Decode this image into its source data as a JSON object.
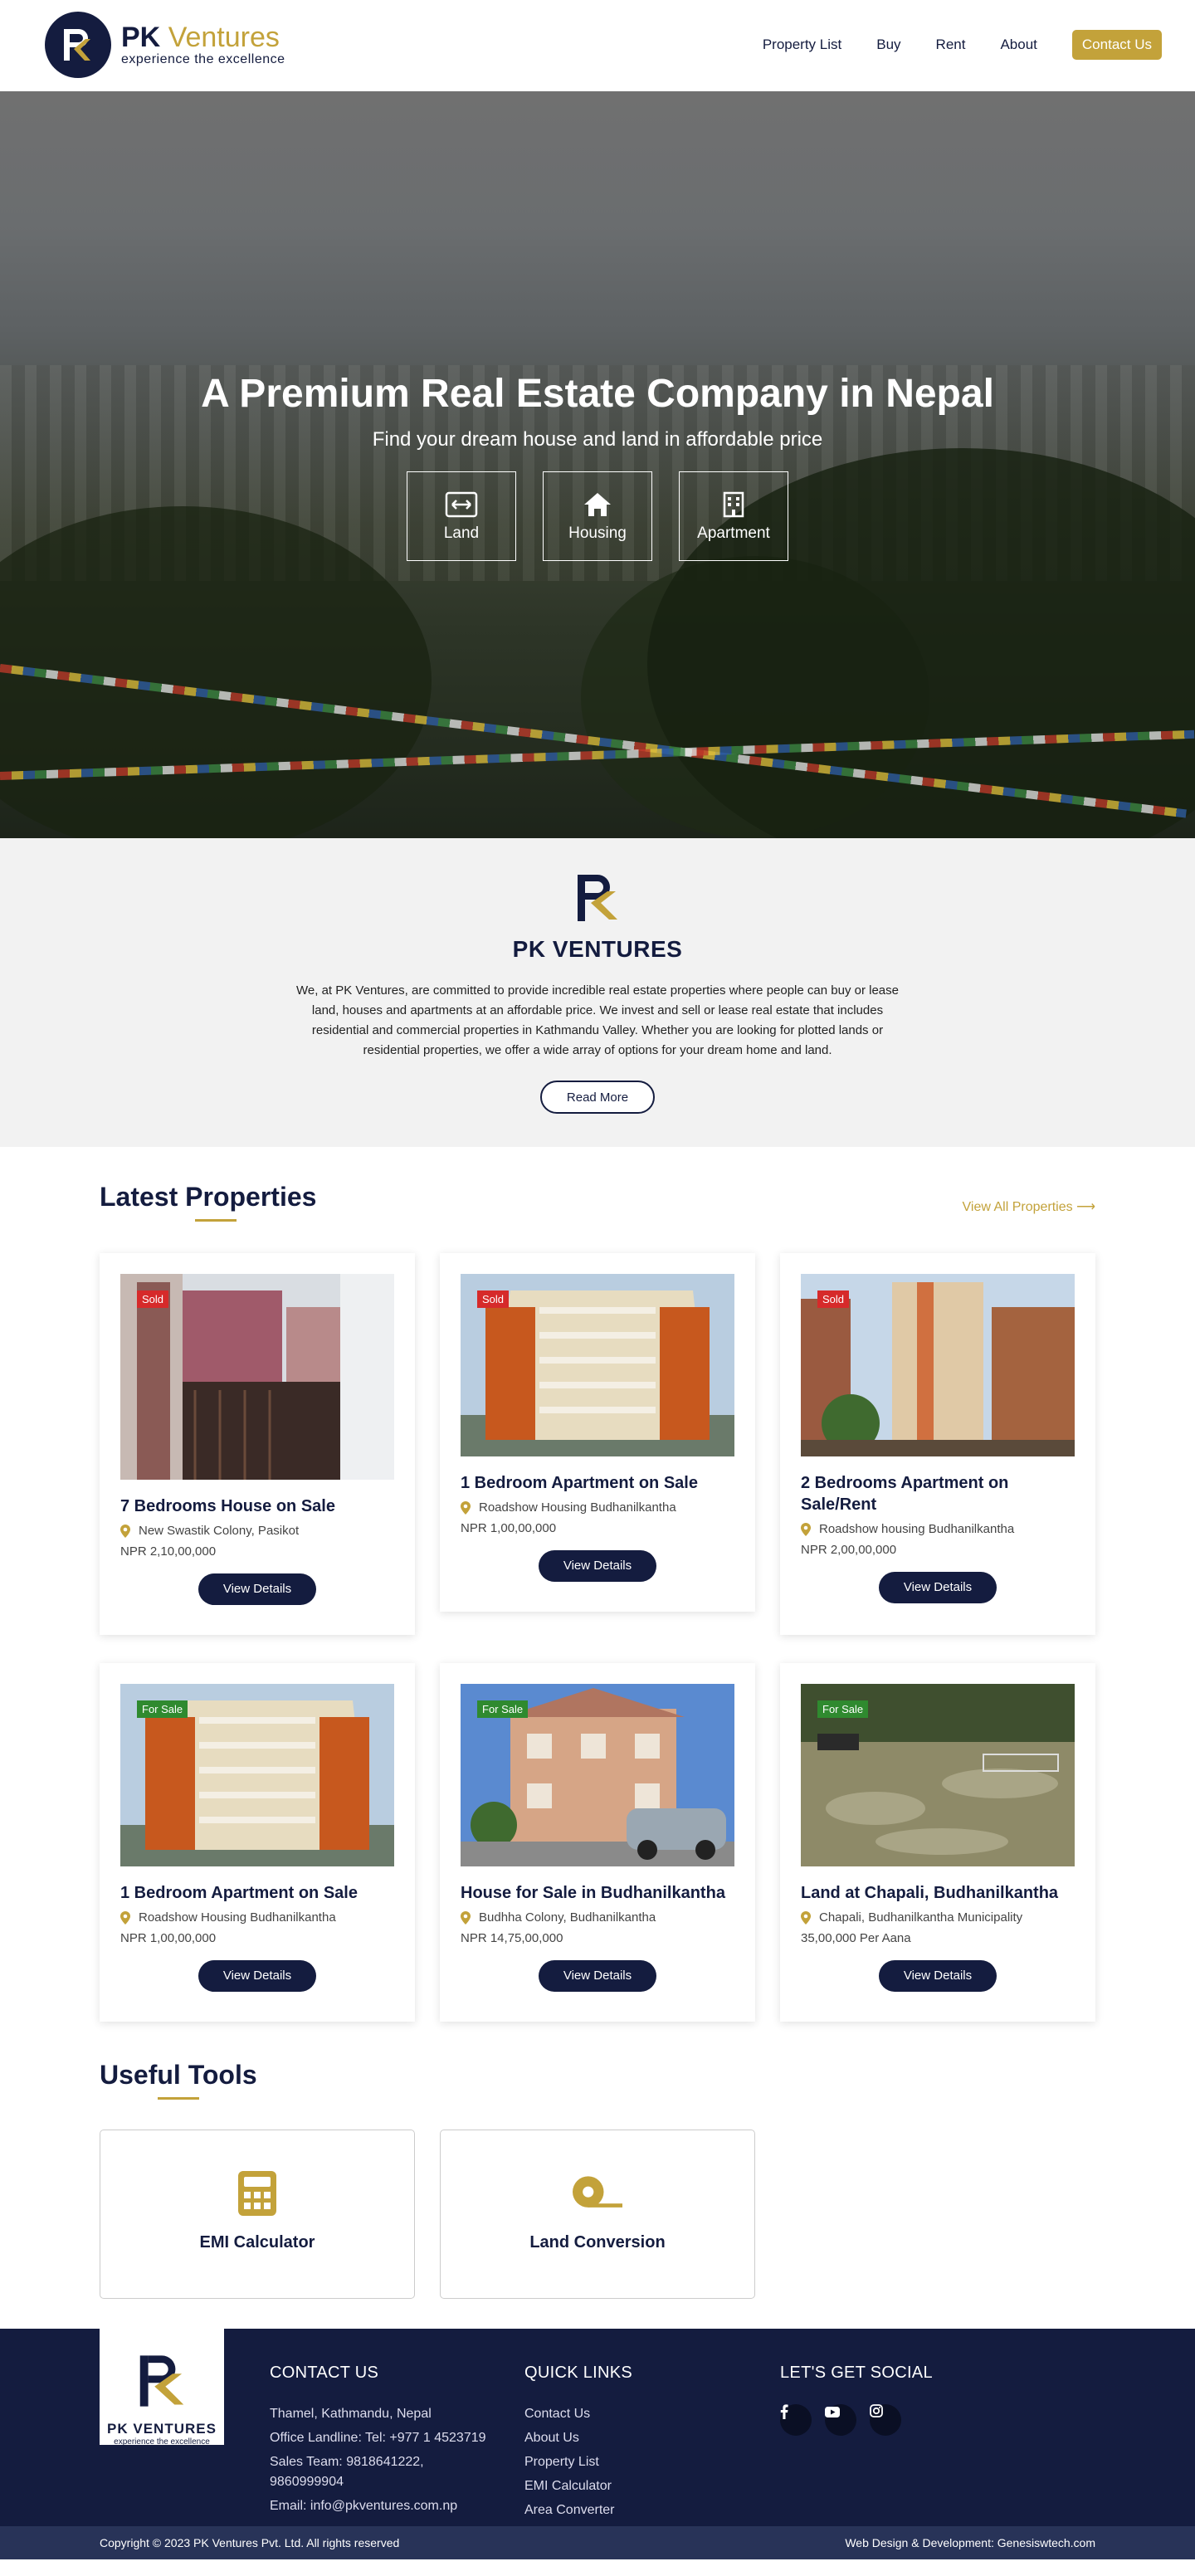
{
  "brand": {
    "name_main": "PK",
    "name_accent": "Ventures",
    "tagline": "experience the excellence",
    "colors": {
      "navy": "#141c3f",
      "gold": "#c3a23a",
      "sold": "#d62a2a",
      "for_sale": "#2f8a2f"
    }
  },
  "nav": {
    "items": [
      {
        "label": "Property List"
      },
      {
        "label": "Buy"
      },
      {
        "label": "Rent"
      },
      {
        "label": "About"
      }
    ],
    "cta": "Contact Us"
  },
  "hero": {
    "title": "A Premium Real Estate Company in Nepal",
    "subtitle": "Find your dream house and land in affordable price",
    "categories": [
      {
        "label": "Land",
        "icon": "arrows-horizontal-icon"
      },
      {
        "label": "Housing",
        "icon": "house-icon"
      },
      {
        "label": "Apartment",
        "icon": "building-icon"
      }
    ]
  },
  "about": {
    "title": "PK VENTURES",
    "text": "We, at PK Ventures, are committed to provide incredible real estate properties where people can buy or lease land, houses and apartments at an affordable price. We invest and sell or lease real estate that includes residential and commercial properties in Kathmandu Valley. Whether you are looking for plotted lands or residential properties, we offer a wide array of options for your dream home and land.",
    "button": "Read More"
  },
  "latest": {
    "title_light": "Latest",
    "title_bold": "Properties",
    "view_all": "View All Properties ⟶",
    "button_label": "View Details",
    "cards": [
      {
        "badge": "Sold",
        "title": "7 Bedrooms House on Sale",
        "location": "New Swastik Colony, Pasikot",
        "price": "NPR 2,10,00,000"
      },
      {
        "badge": "Sold",
        "title": "1 Bedroom Apartment on Sale",
        "location": "Roadshow Housing Budhanilkantha",
        "price": "NPR 1,00,00,000"
      },
      {
        "badge": "Sold",
        "title": "2 Bedrooms Apartment on Sale/Rent",
        "location": "Roadshow housing Budhanilkantha",
        "price": "NPR 2,00,00,000"
      },
      {
        "badge": "For Sale",
        "title": "1 Bedroom Apartment on Sale",
        "location": "Roadshow Housing Budhanilkantha",
        "price": "NPR 1,00,00,000"
      },
      {
        "badge": "For Sale",
        "title": "House for Sale in Budhanilkantha",
        "location": "Budhha Colony, Budhanilkantha",
        "price": "NPR 14,75,00,000"
      },
      {
        "badge": "For Sale",
        "title": "Land at Chapali, Budhanilkantha",
        "location": "Chapali, Budhanilkantha Municipality",
        "price": "35,00,000 Per Aana"
      }
    ]
  },
  "tools": {
    "title_light": "Useful",
    "title_bold": "Tools",
    "items": [
      {
        "label": "EMI Calculator",
        "icon": "calculator-icon"
      },
      {
        "label": "Land Conversion",
        "icon": "tape-measure-icon"
      }
    ]
  },
  "footer": {
    "logo_title": "PK VENTURES",
    "logo_sub": "experience the excellence",
    "contact": {
      "heading": "CONTACT US",
      "address": "Thamel, Kathmandu, Nepal",
      "landline": "Office Landline: Tel: +977 1 4523719",
      "sales": "Sales Team: 9818641222, 9860999904",
      "email": "Email: info@pkventures.com.np"
    },
    "quick_links": {
      "heading": "QUICK LINKS",
      "items": [
        "Contact Us",
        "About Us",
        "Property List",
        "EMI Calculator",
        "Area Converter"
      ]
    },
    "social": {
      "heading": "LET'S GET SOCIAL",
      "icons": [
        "facebook-icon",
        "youtube-icon",
        "instagram-icon"
      ]
    },
    "copyright": "Copyright © 2023 PK Ventures Pvt. Ltd. All rights reserved",
    "credit": "Web Design & Development: Genesiswtech.com"
  }
}
